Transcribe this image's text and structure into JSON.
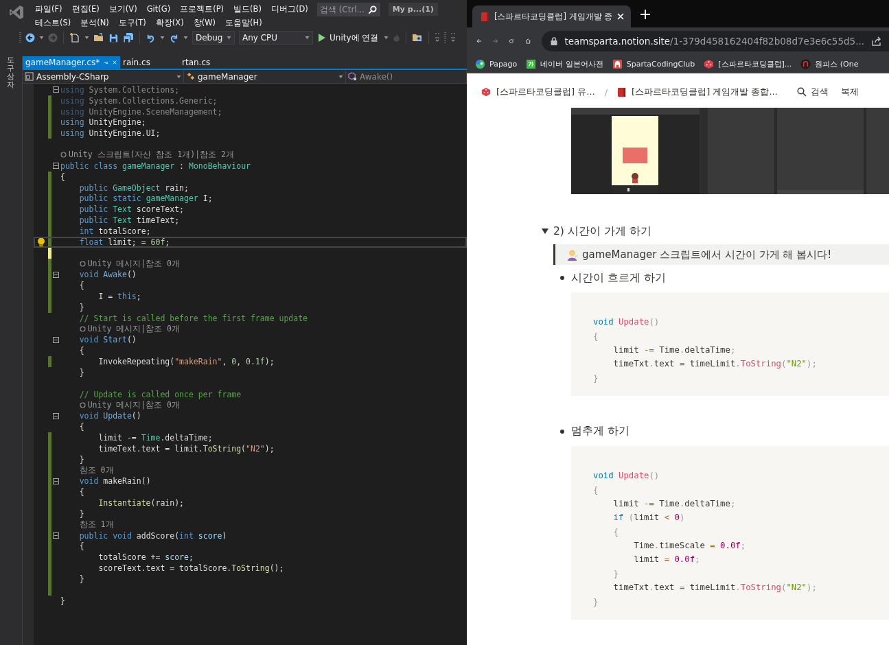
{
  "ide": {
    "menu_rows": [
      [
        "파일(F)",
        "편집(E)",
        "보기(V)",
        "Git(G)",
        "프로젝트(P)",
        "빌드(B)",
        "디버그(D)"
      ],
      [
        "테스트(S)",
        "분석(N)",
        "도구(T)",
        "확장(X)",
        "창(W)",
        "도움말(H)"
      ]
    ],
    "search": {
      "placeholder": "검색 (Ctrl..."
    },
    "profile": "My p...(1)",
    "toolbar": {
      "configuration": "Debug",
      "platform": "Any CPU",
      "run": "Unity에 연결"
    },
    "side_tab": "도구 상자",
    "tabs": [
      {
        "label": "gameManager.cs*",
        "selected": true
      },
      {
        "label": "rain.cs",
        "selected": false
      },
      {
        "label": "rtan.cs",
        "selected": false
      }
    ],
    "nav": [
      "Assembly-CSharp",
      "gameManager",
      "Awake()"
    ],
    "code": [
      {
        "fold": true,
        "tokens": [
          {
            "kind": "dimkw",
            "text": "using"
          },
          {
            "kind": "dim",
            "text": " System.Collections;"
          }
        ]
      },
      {
        "saved_change": true,
        "tokens": [
          {
            "kind": "dimkw",
            "text": "using"
          },
          {
            "kind": "dim",
            "text": " System.Collections.Generic;"
          }
        ]
      },
      {
        "saved_change": true,
        "tokens": [
          {
            "kind": "dimkw",
            "text": "using"
          },
          {
            "kind": "dim",
            "text": " UnityEngine.SceneManagement;"
          }
        ]
      },
      {
        "saved_change": true,
        "tokens": [
          {
            "kind": "kw",
            "text": "using"
          },
          {
            "kind": "tx",
            "text": " UnityEngine;"
          }
        ]
      },
      {
        "saved_change": true,
        "tokens": [
          {
            "kind": "kw",
            "text": "using"
          },
          {
            "kind": "tx",
            "text": " UnityEngine.UI;"
          }
        ]
      },
      {
        "space_before": true,
        "tokens": [
          {
            "kind": "unity-lens",
            "text": "Unity 스크립트(자산 참조 1개)|참조 2개"
          }
        ]
      },
      {
        "fold": true,
        "tokens": [
          {
            "kind": "kw",
            "text": "public class"
          },
          {
            "kind": "type",
            "text": " gameManager"
          },
          {
            "kind": "tx",
            "text": " : "
          },
          {
            "kind": "type",
            "text": "MonoBehaviour"
          }
        ]
      },
      {
        "saved_change": true,
        "tokens": [
          {
            "kind": "tx",
            "text": "{"
          }
        ]
      },
      {
        "saved_change": true,
        "tokens": [
          {
            "kind": "kw",
            "text": "    public"
          },
          {
            "kind": "type",
            "text": " GameObject"
          },
          {
            "kind": "tx",
            "text": " rain;"
          }
        ]
      },
      {
        "saved_change": true,
        "tokens": [
          {
            "kind": "kw",
            "text": "    public static"
          },
          {
            "kind": "type",
            "text": " gameManager"
          },
          {
            "kind": "tx",
            "text": " I;"
          }
        ]
      },
      {
        "saved_change": true,
        "tokens": [
          {
            "kind": "kw",
            "text": "    public"
          },
          {
            "kind": "type",
            "text": " Text"
          },
          {
            "kind": "tx",
            "text": " scoreText;"
          }
        ]
      },
      {
        "saved_change": true,
        "tokens": [
          {
            "kind": "kw",
            "text": "    public"
          },
          {
            "kind": "type",
            "text": " Text"
          },
          {
            "kind": "tx",
            "text": " timeText;"
          }
        ]
      },
      {
        "saved_change": true,
        "tokens": [
          {
            "kind": "kw",
            "text": "    int"
          },
          {
            "kind": "tx",
            "text": " totalScore;"
          }
        ]
      },
      {
        "saved_change": true,
        "current": true,
        "lightbulb": true,
        "tokens": [
          {
            "kind": "kw",
            "text": "    float"
          },
          {
            "kind": "tx",
            "text": " limit; = "
          },
          {
            "kind": "num",
            "text": "60f"
          },
          {
            "kind": "tx",
            "text": ";"
          }
        ]
      },
      {
        "unsaved_change": true
      },
      {
        "saved_change": true,
        "indented": true,
        "tokens": [
          {
            "kind": "unity-lens",
            "text": "Unity 메시지|참조 0개"
          }
        ]
      },
      {
        "saved_change": true,
        "fold": true,
        "tokens": [
          {
            "kind": "kw",
            "text": "    void"
          },
          {
            "kind": "method",
            "text": " Awake"
          },
          {
            "kind": "tx",
            "text": "()"
          }
        ]
      },
      {
        "saved_change": true,
        "tokens": [
          {
            "kind": "tx",
            "text": "    {"
          }
        ]
      },
      {
        "saved_change": true,
        "tokens": [
          {
            "kind": "tx",
            "text": "        I = "
          },
          {
            "kind": "kw",
            "text": "this"
          },
          {
            "kind": "tx",
            "text": ";"
          }
        ]
      },
      {
        "saved_change": true,
        "tokens": [
          {
            "kind": "tx",
            "text": "    }"
          }
        ]
      },
      {
        "tokens": [
          {
            "kind": "cm",
            "text": "    // Start is called before the first frame update"
          }
        ]
      },
      {
        "indented": true,
        "tokens": [
          {
            "kind": "unity-lens",
            "text": "Unity 메시지|참조 0개"
          }
        ]
      },
      {
        "fold": true,
        "tokens": [
          {
            "kind": "kw",
            "text": "    void"
          },
          {
            "kind": "method",
            "text": " Start"
          },
          {
            "kind": "tx",
            "text": "()"
          }
        ]
      },
      {
        "tokens": [
          {
            "kind": "tx",
            "text": "    {"
          }
        ]
      },
      {
        "saved_change": true,
        "tokens": [
          {
            "kind": "tx",
            "text": "        InvokeRepeating("
          },
          {
            "kind": "str",
            "text": "\"makeRain\""
          },
          {
            "kind": "tx",
            "text": ", "
          },
          {
            "kind": "num",
            "text": "0"
          },
          {
            "kind": "tx",
            "text": ", "
          },
          {
            "kind": "num",
            "text": "0.1f"
          },
          {
            "kind": "tx",
            "text": ");"
          }
        ]
      },
      {
        "tokens": [
          {
            "kind": "tx",
            "text": "    }"
          }
        ]
      },
      {
        "space_before": true,
        "tokens": [
          {
            "kind": "cm",
            "text": "    // Update is called once per frame"
          }
        ]
      },
      {
        "indented": true,
        "tokens": [
          {
            "kind": "unity-lens",
            "text": "Unity 메시지|참조 0개"
          }
        ]
      },
      {
        "fold": true,
        "tokens": [
          {
            "kind": "kw",
            "text": "    void"
          },
          {
            "kind": "method",
            "text": " Update"
          },
          {
            "kind": "tx",
            "text": "()"
          }
        ]
      },
      {
        "tokens": [
          {
            "kind": "tx",
            "text": "    {"
          }
        ]
      },
      {
        "saved_change": true,
        "tokens": [
          {
            "kind": "tx",
            "text": "        limit -= "
          },
          {
            "kind": "type",
            "text": "Time"
          },
          {
            "kind": "tx",
            "text": ".deltaTime;"
          }
        ]
      },
      {
        "saved_change": true,
        "tokens": [
          {
            "kind": "tx",
            "text": "        timeText.text = limit."
          },
          {
            "kind": "fn",
            "text": "ToString"
          },
          {
            "kind": "tx",
            "text": "("
          },
          {
            "kind": "str",
            "text": "\"N2\""
          },
          {
            "kind": "tx",
            "text": ");"
          }
        ]
      },
      {
        "saved_change": true,
        "tokens": [
          {
            "kind": "tx",
            "text": "    }"
          }
        ]
      },
      {
        "saved_change": true,
        "tokens": [
          {
            "kind": "lens",
            "text": "    참조 0개"
          }
        ]
      },
      {
        "saved_change": true,
        "fold": true,
        "tokens": [
          {
            "kind": "kw",
            "text": "    void"
          },
          {
            "kind": "tx",
            "text": " makeRain()"
          }
        ]
      },
      {
        "saved_change": true,
        "tokens": [
          {
            "kind": "tx",
            "text": "    {"
          }
        ]
      },
      {
        "saved_change": true,
        "tokens": [
          {
            "kind": "fn",
            "text": "        Instantiate"
          },
          {
            "kind": "tx",
            "text": "(rain);"
          }
        ]
      },
      {
        "saved_change": true,
        "tokens": [
          {
            "kind": "tx",
            "text": "    }"
          }
        ]
      },
      {
        "saved_change": true,
        "tokens": [
          {
            "kind": "lens",
            "text": "    참조 1개"
          }
        ]
      },
      {
        "saved_change": true,
        "fold": true,
        "tokens": [
          {
            "kind": "kw",
            "text": "    public void"
          },
          {
            "kind": "tx",
            "text": " addScore("
          },
          {
            "kind": "kw",
            "text": "int"
          },
          {
            "kind": "var",
            "text": " score"
          },
          {
            "kind": "tx",
            "text": ")"
          }
        ]
      },
      {
        "saved_change": true,
        "tokens": [
          {
            "kind": "tx",
            "text": "    {"
          }
        ]
      },
      {
        "saved_change": true,
        "tokens": [
          {
            "kind": "tx",
            "text": "        totalScore += "
          },
          {
            "kind": "var",
            "text": "score"
          },
          {
            "kind": "tx",
            "text": ";"
          }
        ]
      },
      {
        "saved_change": true,
        "tokens": [
          {
            "kind": "tx",
            "text": "        scoreText.text = totalScore."
          },
          {
            "kind": "fn",
            "text": "ToString"
          },
          {
            "kind": "tx",
            "text": "();"
          }
        ]
      },
      {
        "saved_change": true,
        "tokens": [
          {
            "kind": "tx",
            "text": "    }"
          }
        ]
      },
      {
        "saved_change": true
      },
      {
        "tokens": [
          {
            "kind": "tx",
            "text": "}"
          }
        ]
      }
    ]
  },
  "browser": {
    "tab": {
      "title": "[스파르타코딩클럽] 게임개발 종"
    },
    "url": {
      "host": "teamsparta.notion.site",
      "path": "/1-379d458162404f82b08d7e3e6c55d5..."
    },
    "bookmarks": [
      {
        "kind": "papago",
        "label": "Papago"
      },
      {
        "kind": "naver",
        "label": "네이버 일본어사전"
      },
      {
        "kind": "sparta",
        "label": "SpartaCodingClub"
      },
      {
        "kind": "dice",
        "label": "[스파르타코딩클럽]..."
      },
      {
        "kind": "onepiece",
        "label": "원피스 (One"
      }
    ],
    "breadcrumbs": [
      {
        "kind": "dice",
        "label": "[스파르타코딩클럽] 유..."
      },
      {
        "kind": "book",
        "label": "[스파르타코딩클럽] 게임개발 종합..."
      }
    ],
    "breadcrumb_separator": "/",
    "actions": [
      "검색",
      "복제"
    ],
    "toggle": {
      "label": "2) 시간이 가게 하기",
      "expanded": true
    },
    "callout": "gameManager 스크립트에서 시간이 가게 해 봅시다!",
    "bullets": [
      {
        "text": "시간이 흐르게 하기",
        "code": [
          [
            {
              "kind": "kw",
              "text": "void"
            },
            {
              "kind": "fn",
              "text": " Update"
            },
            {
              "kind": "p",
              "text": "()"
            }
          ],
          [
            {
              "kind": "p",
              "text": "{"
            }
          ],
          [
            {
              "kind": "tx",
              "text": "    limit "
            },
            {
              "kind": "op",
              "text": "-="
            },
            {
              "kind": "tx",
              "text": " Time"
            },
            {
              "kind": "p",
              "text": "."
            },
            {
              "kind": "tx",
              "text": "deltaTime"
            },
            {
              "kind": "p",
              "text": ";"
            }
          ],
          [
            {
              "kind": "tx",
              "text": "    timeTxt"
            },
            {
              "kind": "p",
              "text": "."
            },
            {
              "kind": "tx",
              "text": "text "
            },
            {
              "kind": "op",
              "text": "="
            },
            {
              "kind": "tx",
              "text": " timeLimit"
            },
            {
              "kind": "p",
              "text": "."
            },
            {
              "kind": "fn",
              "text": "ToString"
            },
            {
              "kind": "p",
              "text": "("
            },
            {
              "kind": "str",
              "text": "\"N2\""
            },
            {
              "kind": "p",
              "text": ");"
            }
          ],
          [
            {
              "kind": "p",
              "text": "}"
            }
          ]
        ]
      },
      {
        "text": "멈추게 하기",
        "code": [
          [
            {
              "kind": "kw",
              "text": "void"
            },
            {
              "kind": "fn",
              "text": " Update"
            },
            {
              "kind": "p",
              "text": "()"
            }
          ],
          [
            {
              "kind": "p",
              "text": "{"
            }
          ],
          [
            {
              "kind": "tx",
              "text": "    limit "
            },
            {
              "kind": "op",
              "text": "-="
            },
            {
              "kind": "tx",
              "text": " Time"
            },
            {
              "kind": "p",
              "text": "."
            },
            {
              "kind": "tx",
              "text": "deltaTime"
            },
            {
              "kind": "p",
              "text": ";"
            }
          ],
          [
            {
              "kind": "kw",
              "text": "    if"
            },
            {
              "kind": "p",
              "text": " ("
            },
            {
              "kind": "tx",
              "text": "limit "
            },
            {
              "kind": "op",
              "text": "<"
            },
            {
              "kind": "num",
              "text": " 0"
            },
            {
              "kind": "p",
              "text": ")"
            }
          ],
          [
            {
              "kind": "p",
              "text": "    {"
            }
          ],
          [
            {
              "kind": "tx",
              "text": "        Time"
            },
            {
              "kind": "p",
              "text": "."
            },
            {
              "kind": "tx",
              "text": "timeScale "
            },
            {
              "kind": "op",
              "text": "="
            },
            {
              "kind": "num",
              "text": " 0.0f"
            },
            {
              "kind": "p",
              "text": ";"
            }
          ],
          [
            {
              "kind": "tx",
              "text": "        limit "
            },
            {
              "kind": "op",
              "text": "="
            },
            {
              "kind": "num",
              "text": " 0.0f"
            },
            {
              "kind": "p",
              "text": ";"
            }
          ],
          [
            {
              "kind": "p",
              "text": "    }"
            }
          ],
          [
            {
              "kind": "tx",
              "text": "    timeTxt"
            },
            {
              "kind": "p",
              "text": "."
            },
            {
              "kind": "tx",
              "text": "text "
            },
            {
              "kind": "op",
              "text": "="
            },
            {
              "kind": "tx",
              "text": " timeLimit"
            },
            {
              "kind": "p",
              "text": "."
            },
            {
              "kind": "fn",
              "text": "ToString"
            },
            {
              "kind": "p",
              "text": "("
            },
            {
              "kind": "str",
              "text": "\"N2\""
            },
            {
              "kind": "p",
              "text": ");"
            }
          ],
          [
            {
              "kind": "p",
              "text": "}"
            }
          ]
        ]
      }
    ]
  }
}
